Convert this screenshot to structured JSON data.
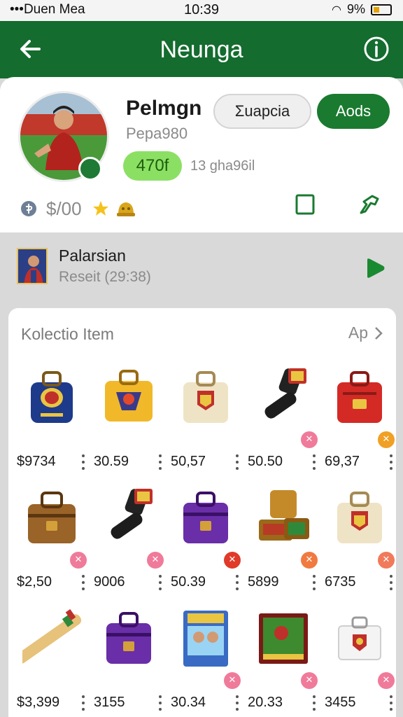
{
  "status_bar": {
    "carrier": "•••Duen Mea",
    "time": "10:39",
    "battery": "9%"
  },
  "header": {
    "title": "Neunga"
  },
  "profile": {
    "name": "Pelmgn",
    "username": "Pepa980",
    "follow_label": "Σuapcia",
    "add_label": "Aods",
    "level_pill": "470f",
    "meta": "13 gha96il",
    "balance": "$/00"
  },
  "recent": {
    "title": "Palarsian",
    "subtitle": "Reseit (29:38)"
  },
  "collection": {
    "title": "Kolectio Item",
    "more_label": "Ap",
    "items": [
      {
        "kind": "navy-bag",
        "price": "$9734",
        "badge_color": ""
      },
      {
        "kind": "yellow-bag",
        "price": "30.59",
        "badge_color": ""
      },
      {
        "kind": "cream-bag",
        "price": "50,57",
        "badge_color": ""
      },
      {
        "kind": "black-tool",
        "price": "50.50",
        "badge_color": "#f07a9a"
      },
      {
        "kind": "red-bag",
        "price": "69,37",
        "badge_color": "#f0a024"
      },
      {
        "kind": "brown-bag",
        "price": "$2,50",
        "badge_color": "#f07a9a"
      },
      {
        "kind": "black-tool",
        "price": "9006",
        "badge_color": "#f07a9a"
      },
      {
        "kind": "purple-bag",
        "price": "50.39",
        "badge_color": "#e03a2a"
      },
      {
        "kind": "food-box",
        "price": "5899",
        "badge_color": "#f07a40"
      },
      {
        "kind": "cream-bag",
        "price": "6735",
        "badge_color": "#f07a5a"
      },
      {
        "kind": "wood-stick",
        "price": "$3,399",
        "badge_color": ""
      },
      {
        "kind": "purple-bag",
        "price": "3155",
        "badge_color": ""
      },
      {
        "kind": "card-box",
        "price": "30.34",
        "badge_color": "#f07a9a"
      },
      {
        "kind": "pitch-box",
        "price": "20.33",
        "badge_color": "#f07a9a"
      },
      {
        "kind": "white-case",
        "price": "3455",
        "badge_color": "#f07a9a"
      }
    ]
  },
  "colors": {
    "brand": "#146c2e",
    "accent": "#1a7a30",
    "pill": "#8be064"
  }
}
